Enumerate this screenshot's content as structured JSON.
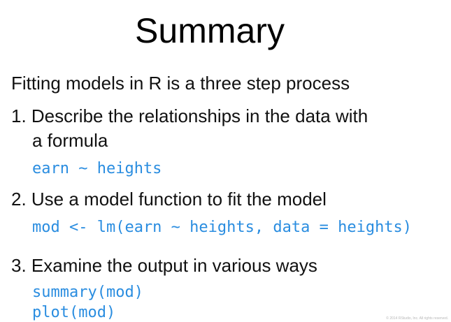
{
  "slide": {
    "title": "Summary",
    "intro": "Fitting models in R is a three step process",
    "steps": [
      {
        "text_line1": "1. Describe the relationships in the data with",
        "text_line2": "a formula",
        "code": [
          "earn ~ heights"
        ]
      },
      {
        "text_line1": "2. Use a model function to fit the model",
        "code": [
          "mod <- lm(earn ~ heights, data = heights)"
        ]
      },
      {
        "text_line1": "3. Examine the output in various ways",
        "code": [
          "summary(mod)",
          "plot(mod)"
        ]
      }
    ],
    "footer": "© 2014 RStudio, Inc. All rights reserved.",
    "colors": {
      "code": "#2a8de0",
      "text": "#111111",
      "background": "#ffffff"
    }
  }
}
